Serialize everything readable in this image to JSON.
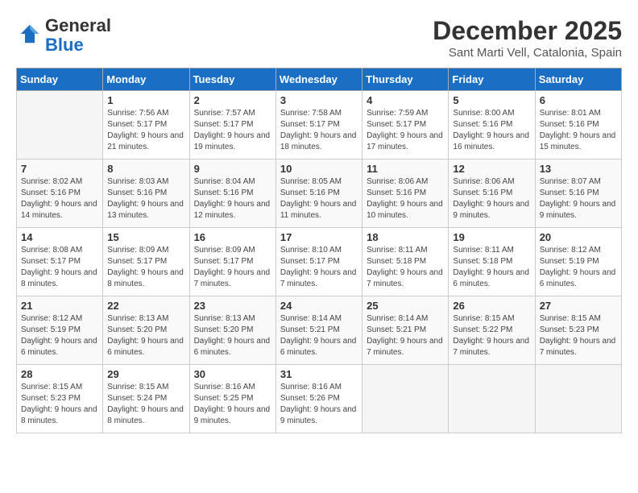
{
  "header": {
    "logo_general": "General",
    "logo_blue": "Blue",
    "month_title": "December 2025",
    "location": "Sant Marti Vell, Catalonia, Spain"
  },
  "days_of_week": [
    "Sunday",
    "Monday",
    "Tuesday",
    "Wednesday",
    "Thursday",
    "Friday",
    "Saturday"
  ],
  "weeks": [
    [
      {
        "day": "",
        "sunrise": "",
        "sunset": "",
        "daylight": "",
        "empty": true
      },
      {
        "day": "1",
        "sunrise": "Sunrise: 7:56 AM",
        "sunset": "Sunset: 5:17 PM",
        "daylight": "Daylight: 9 hours and 21 minutes."
      },
      {
        "day": "2",
        "sunrise": "Sunrise: 7:57 AM",
        "sunset": "Sunset: 5:17 PM",
        "daylight": "Daylight: 9 hours and 19 minutes."
      },
      {
        "day": "3",
        "sunrise": "Sunrise: 7:58 AM",
        "sunset": "Sunset: 5:17 PM",
        "daylight": "Daylight: 9 hours and 18 minutes."
      },
      {
        "day": "4",
        "sunrise": "Sunrise: 7:59 AM",
        "sunset": "Sunset: 5:17 PM",
        "daylight": "Daylight: 9 hours and 17 minutes."
      },
      {
        "day": "5",
        "sunrise": "Sunrise: 8:00 AM",
        "sunset": "Sunset: 5:16 PM",
        "daylight": "Daylight: 9 hours and 16 minutes."
      },
      {
        "day": "6",
        "sunrise": "Sunrise: 8:01 AM",
        "sunset": "Sunset: 5:16 PM",
        "daylight": "Daylight: 9 hours and 15 minutes."
      }
    ],
    [
      {
        "day": "7",
        "sunrise": "Sunrise: 8:02 AM",
        "sunset": "Sunset: 5:16 PM",
        "daylight": "Daylight: 9 hours and 14 minutes."
      },
      {
        "day": "8",
        "sunrise": "Sunrise: 8:03 AM",
        "sunset": "Sunset: 5:16 PM",
        "daylight": "Daylight: 9 hours and 13 minutes."
      },
      {
        "day": "9",
        "sunrise": "Sunrise: 8:04 AM",
        "sunset": "Sunset: 5:16 PM",
        "daylight": "Daylight: 9 hours and 12 minutes."
      },
      {
        "day": "10",
        "sunrise": "Sunrise: 8:05 AM",
        "sunset": "Sunset: 5:16 PM",
        "daylight": "Daylight: 9 hours and 11 minutes."
      },
      {
        "day": "11",
        "sunrise": "Sunrise: 8:06 AM",
        "sunset": "Sunset: 5:16 PM",
        "daylight": "Daylight: 9 hours and 10 minutes."
      },
      {
        "day": "12",
        "sunrise": "Sunrise: 8:06 AM",
        "sunset": "Sunset: 5:16 PM",
        "daylight": "Daylight: 9 hours and 9 minutes."
      },
      {
        "day": "13",
        "sunrise": "Sunrise: 8:07 AM",
        "sunset": "Sunset: 5:16 PM",
        "daylight": "Daylight: 9 hours and 9 minutes."
      }
    ],
    [
      {
        "day": "14",
        "sunrise": "Sunrise: 8:08 AM",
        "sunset": "Sunset: 5:17 PM",
        "daylight": "Daylight: 9 hours and 8 minutes."
      },
      {
        "day": "15",
        "sunrise": "Sunrise: 8:09 AM",
        "sunset": "Sunset: 5:17 PM",
        "daylight": "Daylight: 9 hours and 8 minutes."
      },
      {
        "day": "16",
        "sunrise": "Sunrise: 8:09 AM",
        "sunset": "Sunset: 5:17 PM",
        "daylight": "Daylight: 9 hours and 7 minutes."
      },
      {
        "day": "17",
        "sunrise": "Sunrise: 8:10 AM",
        "sunset": "Sunset: 5:17 PM",
        "daylight": "Daylight: 9 hours and 7 minutes."
      },
      {
        "day": "18",
        "sunrise": "Sunrise: 8:11 AM",
        "sunset": "Sunset: 5:18 PM",
        "daylight": "Daylight: 9 hours and 7 minutes."
      },
      {
        "day": "19",
        "sunrise": "Sunrise: 8:11 AM",
        "sunset": "Sunset: 5:18 PM",
        "daylight": "Daylight: 9 hours and 6 minutes."
      },
      {
        "day": "20",
        "sunrise": "Sunrise: 8:12 AM",
        "sunset": "Sunset: 5:19 PM",
        "daylight": "Daylight: 9 hours and 6 minutes."
      }
    ],
    [
      {
        "day": "21",
        "sunrise": "Sunrise: 8:12 AM",
        "sunset": "Sunset: 5:19 PM",
        "daylight": "Daylight: 9 hours and 6 minutes."
      },
      {
        "day": "22",
        "sunrise": "Sunrise: 8:13 AM",
        "sunset": "Sunset: 5:20 PM",
        "daylight": "Daylight: 9 hours and 6 minutes."
      },
      {
        "day": "23",
        "sunrise": "Sunrise: 8:13 AM",
        "sunset": "Sunset: 5:20 PM",
        "daylight": "Daylight: 9 hours and 6 minutes."
      },
      {
        "day": "24",
        "sunrise": "Sunrise: 8:14 AM",
        "sunset": "Sunset: 5:21 PM",
        "daylight": "Daylight: 9 hours and 6 minutes."
      },
      {
        "day": "25",
        "sunrise": "Sunrise: 8:14 AM",
        "sunset": "Sunset: 5:21 PM",
        "daylight": "Daylight: 9 hours and 7 minutes."
      },
      {
        "day": "26",
        "sunrise": "Sunrise: 8:15 AM",
        "sunset": "Sunset: 5:22 PM",
        "daylight": "Daylight: 9 hours and 7 minutes."
      },
      {
        "day": "27",
        "sunrise": "Sunrise: 8:15 AM",
        "sunset": "Sunset: 5:23 PM",
        "daylight": "Daylight: 9 hours and 7 minutes."
      }
    ],
    [
      {
        "day": "28",
        "sunrise": "Sunrise: 8:15 AM",
        "sunset": "Sunset: 5:23 PM",
        "daylight": "Daylight: 9 hours and 8 minutes."
      },
      {
        "day": "29",
        "sunrise": "Sunrise: 8:15 AM",
        "sunset": "Sunset: 5:24 PM",
        "daylight": "Daylight: 9 hours and 8 minutes."
      },
      {
        "day": "30",
        "sunrise": "Sunrise: 8:16 AM",
        "sunset": "Sunset: 5:25 PM",
        "daylight": "Daylight: 9 hours and 9 minutes."
      },
      {
        "day": "31",
        "sunrise": "Sunrise: 8:16 AM",
        "sunset": "Sunset: 5:26 PM",
        "daylight": "Daylight: 9 hours and 9 minutes."
      },
      {
        "day": "",
        "sunrise": "",
        "sunset": "",
        "daylight": "",
        "empty": true
      },
      {
        "day": "",
        "sunrise": "",
        "sunset": "",
        "daylight": "",
        "empty": true
      },
      {
        "day": "",
        "sunrise": "",
        "sunset": "",
        "daylight": "",
        "empty": true
      }
    ]
  ]
}
